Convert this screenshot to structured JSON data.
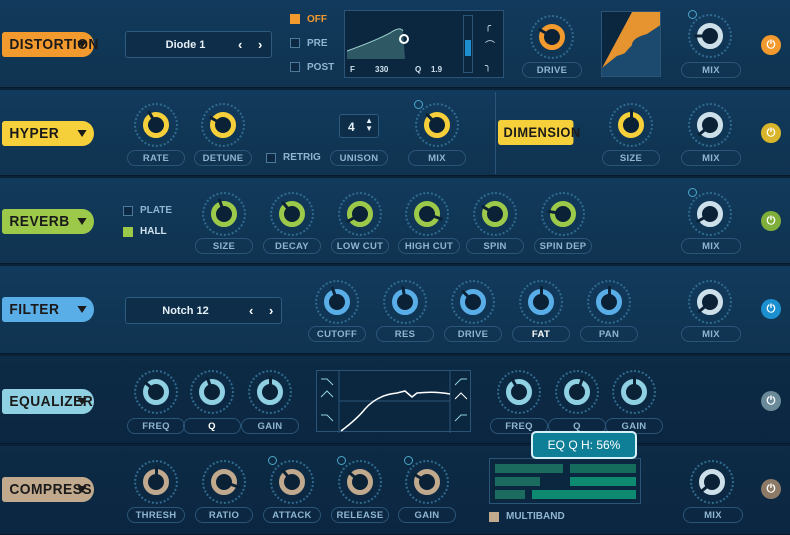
{
  "distortion": {
    "name": "DISTORTION",
    "mode": "Diode 1",
    "pos_off": "OFF",
    "pos_pre": "PRE",
    "pos_post": "POST",
    "f_label": "F",
    "f_value": "330",
    "q_label": "Q",
    "q_value": "1.9",
    "drive": "DRIVE",
    "mix": "MIX",
    "color": "#f29a2e"
  },
  "hyper": {
    "name": "HYPER",
    "rate": "RATE",
    "detune": "DETUNE",
    "retrig": "RETRIG",
    "unison_value": "4",
    "unison": "UNISON",
    "mix": "MIX",
    "color": "#f5d03a"
  },
  "dimension": {
    "name": "DIMENSION",
    "size": "SIZE",
    "mix": "MIX"
  },
  "reverb": {
    "name": "REVERB",
    "plate": "PLATE",
    "hall": "HALL",
    "size": "SIZE",
    "decay": "DECAY",
    "low_cut": "LOW CUT",
    "high_cut": "HIGH CUT",
    "spin": "SPIN",
    "spin_depth": "SPIN DEP",
    "mix": "MIX",
    "color": "#9cc94a"
  },
  "filter": {
    "name": "FILTER",
    "mode": "Notch 12",
    "cutoff": "CUTOFF",
    "res": "RES",
    "drive": "DRIVE",
    "fat": "FAT",
    "pan": "PAN",
    "mix": "MIX",
    "color": "#5aaee8"
  },
  "equalizer": {
    "name": "EQUALIZER",
    "freq1": "FREQ",
    "q1": "Q",
    "gain1": "GAIN",
    "freq2": "FREQ",
    "q2": "Q",
    "gain2": "GAIN",
    "color": "#8fd0e2"
  },
  "compressor": {
    "name": "COMPRESS",
    "thresh": "THRESH",
    "ratio": "RATIO",
    "attack": "ATTACK",
    "release": "RELEASE",
    "gain": "GAIN",
    "multiband": "MULTIBAND",
    "mix": "MIX",
    "color": "#c1a98e"
  },
  "tooltip": {
    "text": "EQ Q H: 56%"
  },
  "icons": {
    "nav_prev": "‹",
    "nav_next": "›",
    "power": "⏻"
  }
}
